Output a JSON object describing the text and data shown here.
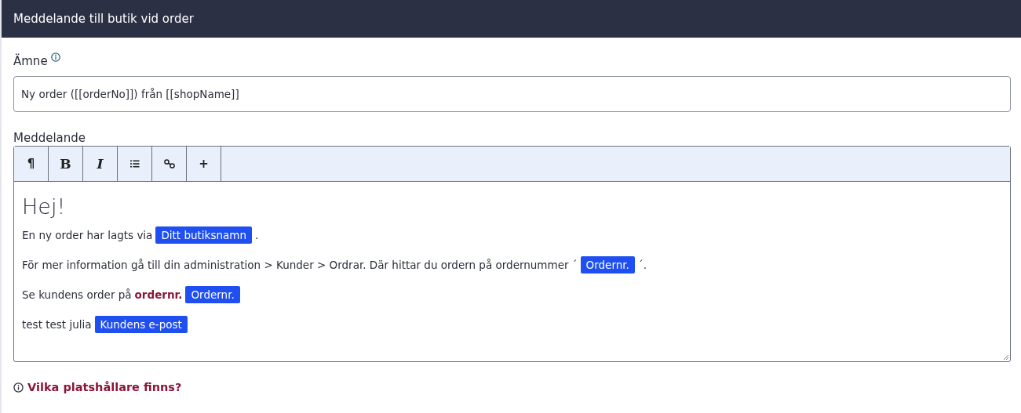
{
  "header": {
    "title": "Meddelande till butik vid order"
  },
  "subject": {
    "label": "Ämne",
    "value": "Ny order ([[orderNo]]) från [[shopName]]"
  },
  "message": {
    "label": "Meddelande",
    "toolbar": [
      {
        "kind": "text",
        "label": "¶"
      },
      {
        "kind": "bold",
        "label": "B"
      },
      {
        "kind": "italic",
        "label": "I"
      },
      {
        "kind": "list"
      },
      {
        "kind": "link"
      },
      {
        "kind": "text",
        "label": "+"
      }
    ],
    "heading": "Hej!",
    "paragraphs": [
      {
        "segments": [
          {
            "kind": "text",
            "text": "En ny order har lagts via"
          },
          {
            "kind": "tag",
            "text": "Ditt butiksnamn"
          },
          {
            "kind": "text",
            "text": "."
          }
        ]
      },
      {
        "segments": [
          {
            "kind": "text",
            "text": "För mer information gå till din administration > Kunder > Ordrar. Där hittar du ordern på ordernummer ´"
          },
          {
            "kind": "tag",
            "text": "Ordernr."
          },
          {
            "kind": "text",
            "text": "´."
          }
        ]
      },
      {
        "segments": [
          {
            "kind": "text",
            "text": "Se kundens order på"
          },
          {
            "kind": "strong",
            "text": "ordernr."
          },
          {
            "kind": "tag",
            "text": "Ordernr."
          }
        ]
      },
      {
        "segments": [
          {
            "kind": "text",
            "text": "test test julia"
          },
          {
            "kind": "tag",
            "text": "Kundens e-post"
          }
        ]
      }
    ]
  },
  "help_link": {
    "text": "Vilka platshållare finns?"
  }
}
